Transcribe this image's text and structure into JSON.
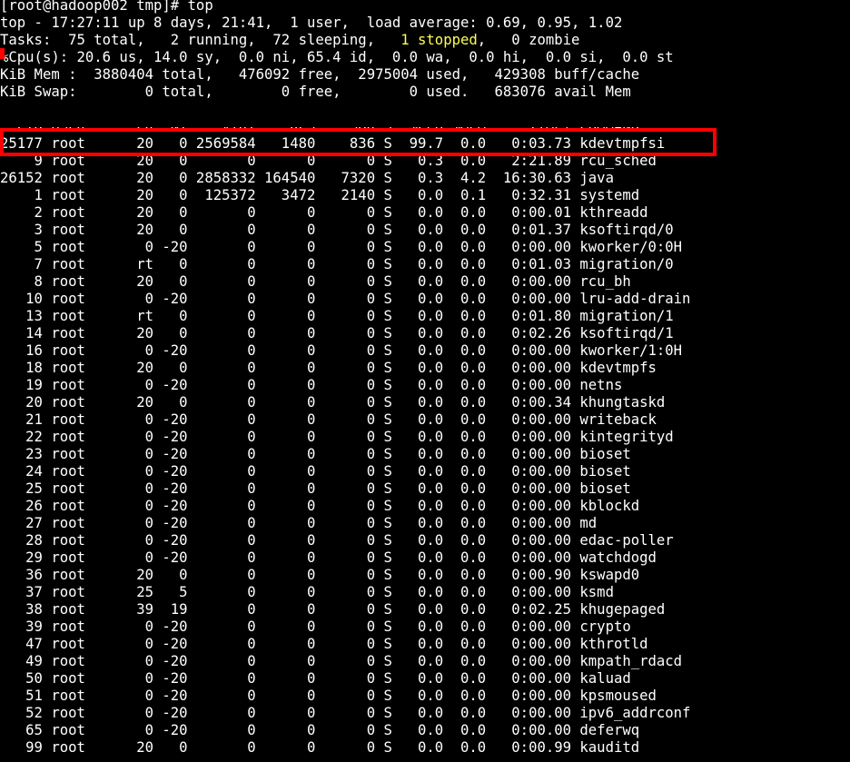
{
  "prompt": "[root@hadoop002 tmp]# top",
  "summary": {
    "top_line": "top - 17:27:11 up 8 days, 21:41,  1 user,  load average: 0.69, 0.95, 1.02",
    "tasks_prefix": "Tasks:  75 total,   2 running,  72 sleeping,   ",
    "tasks_stopped": "1 stopped",
    "tasks_suffix": ",   0 zombie",
    "cpu_line": "%Cpu(s): 20.6 us, 14.0 sy,  0.0 ni, 65.4 id,  0.0 wa,  0.0 hi,  0.0 si,  0.0 st",
    "mem_line": "KiB Mem :  3880404 total,   476092 free,  2975004 used,   429308 buff/cache",
    "swap_line": "KiB Swap:        0 total,        0 free,        0 used.   683076 avail Mem"
  },
  "columns_line": "  PID USER      PR  NI    VIRT    RES    SHR S  %CPU %MEM     TIME+ COMMAND",
  "process_rows": [
    "25177 root      20   0 2569584   1480    836 S  99.7  0.0   0:03.73 kdevtmpfsi",
    "    9 root      20   0       0      0      0 S   0.3  0.0   2:21.89 rcu_sched",
    "26152 root      20   0 2858332 164540   7320 S   0.3  4.2  16:30.63 java",
    "    1 root      20   0  125372   3472   2140 S   0.0  0.1   0:32.31 systemd",
    "    2 root      20   0       0      0      0 S   0.0  0.0   0:00.01 kthreadd",
    "    3 root      20   0       0      0      0 S   0.0  0.0   0:01.37 ksoftirqd/0",
    "    5 root       0 -20       0      0      0 S   0.0  0.0   0:00.00 kworker/0:0H",
    "    7 root      rt   0       0      0      0 S   0.0  0.0   0:01.03 migration/0",
    "    8 root      20   0       0      0      0 S   0.0  0.0   0:00.00 rcu_bh",
    "   10 root       0 -20       0      0      0 S   0.0  0.0   0:00.00 lru-add-drain",
    "   13 root      rt   0       0      0      0 S   0.0  0.0   0:01.80 migration/1",
    "   14 root      20   0       0      0      0 S   0.0  0.0   0:02.26 ksoftirqd/1",
    "   16 root       0 -20       0      0      0 S   0.0  0.0   0:00.00 kworker/1:0H",
    "   18 root      20   0       0      0      0 S   0.0  0.0   0:00.00 kdevtmpfs",
    "   19 root       0 -20       0      0      0 S   0.0  0.0   0:00.00 netns",
    "   20 root      20   0       0      0      0 S   0.0  0.0   0:00.34 khungtaskd",
    "   21 root       0 -20       0      0      0 S   0.0  0.0   0:00.00 writeback",
    "   22 root       0 -20       0      0      0 S   0.0  0.0   0:00.00 kintegrityd",
    "   23 root       0 -20       0      0      0 S   0.0  0.0   0:00.00 bioset",
    "   24 root       0 -20       0      0      0 S   0.0  0.0   0:00.00 bioset",
    "   25 root       0 -20       0      0      0 S   0.0  0.0   0:00.00 bioset",
    "   26 root       0 -20       0      0      0 S   0.0  0.0   0:00.00 kblockd",
    "   27 root       0 -20       0      0      0 S   0.0  0.0   0:00.00 md",
    "   28 root       0 -20       0      0      0 S   0.0  0.0   0:00.00 edac-poller",
    "   29 root       0 -20       0      0      0 S   0.0  0.0   0:00.00 watchdogd",
    "   36 root      20   0       0      0      0 S   0.0  0.0   0:00.90 kswapd0",
    "   37 root      25   5       0      0      0 S   0.0  0.0   0:00.00 ksmd",
    "   38 root      39  19       0      0      0 S   0.0  0.0   0:02.25 khugepaged",
    "   39 root       0 -20       0      0      0 S   0.0  0.0   0:00.00 crypto",
    "   47 root       0 -20       0      0      0 S   0.0  0.0   0:00.00 kthrotld",
    "   49 root       0 -20       0      0      0 S   0.0  0.0   0:00.00 kmpath_rdacd",
    "   50 root       0 -20       0      0      0 S   0.0  0.0   0:00.00 kaluad",
    "   51 root       0 -20       0      0      0 S   0.0  0.0   0:00.00 kpsmoused",
    "   52 root       0 -20       0      0      0 S   0.0  0.0   0:00.00 ipv6_addrconf",
    "   65 root       0 -20       0      0      0 S   0.0  0.0   0:00.00 deferwq",
    "   99 root      20   0       0      0      0 S   0.0  0.0   0:00.99 kauditd"
  ],
  "colors": {
    "background": "#000000",
    "text": "#ffffff",
    "stopped": "#ffff55",
    "highlight_box": "#ff0000"
  }
}
